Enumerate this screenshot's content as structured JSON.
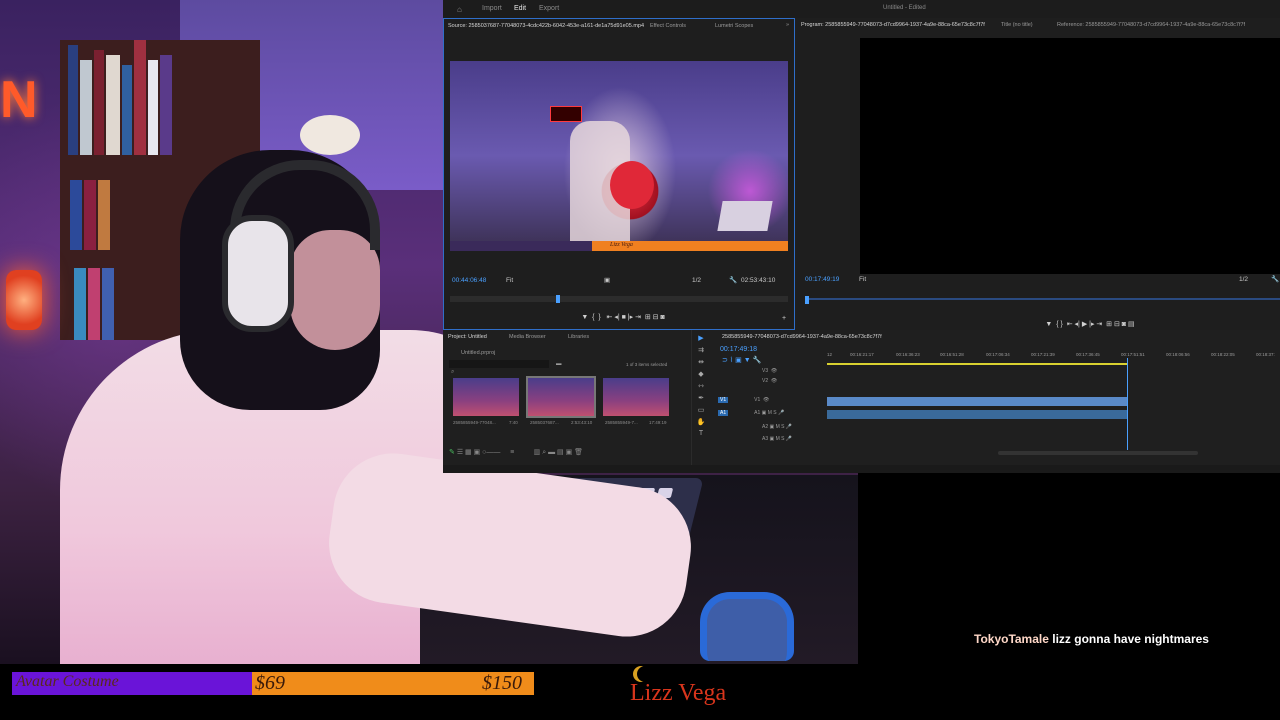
{
  "app": {
    "window_title": "Untitled - Edited",
    "menu": [
      "Import",
      "Edit",
      "Export"
    ],
    "active_menu": "Edit"
  },
  "source": {
    "tab_label": "Source: 2585037687-77048073-4cdc422b-6042-453e-a161-de1a75d91e05.mp4",
    "other_tabs": [
      "Effect Controls",
      "Lumetri Scopes"
    ],
    "timecode": "00:44:06:48",
    "fit": "Fit",
    "scale": "1/2",
    "duration": "02:53:43:10",
    "video_overlay_name": "Lizz Vega"
  },
  "program": {
    "tab_label": "Program: 2585855949-77048073-d7cd9964-1937-4a9e-88ca-65e73c8c7f7f",
    "other_tabs": [
      "Title (no title)",
      "Reference: 2585855949-77048073-d7cd9964-1937-4a9e-88ca-65e73c8c7f7f"
    ],
    "timecode": "00:17:49:19",
    "fit": "Fit",
    "scale": "1/2"
  },
  "project": {
    "tabs": [
      "Project: Untitled",
      "Media Browser",
      "Libraries"
    ],
    "bin": "Untitled.prproj",
    "selection_info": "1 of 3 items selected",
    "clips": [
      {
        "name": "2585855949-77048...",
        "duration": "7:40"
      },
      {
        "name": "2585037687...",
        "duration": "2:53:43:10"
      },
      {
        "name": "2585855949-7...",
        "duration": "17:49:19"
      }
    ]
  },
  "timeline": {
    "tab_label": "2585855949-77048073-d7cd9964-1937-4a9e-88ca-65e73c8c7f7f",
    "timecode": "00:17:49:18",
    "ruler": [
      "12",
      "00:16:21:17",
      "00:16:36:23",
      "00:16:51:28",
      "00:17:06:34",
      "00:17:21:39",
      "00:17:36:45",
      "00:17:51:51",
      "00:18:06:56",
      "00:18:22:05",
      "00:18:37:"
    ],
    "video_tracks": [
      "V3",
      "V2",
      "V1"
    ],
    "audio_tracks": [
      "A1",
      "A2",
      "A3"
    ]
  },
  "overlay": {
    "chat_user": "TokyoTamale",
    "chat_message": "lizz gonna have nightmares",
    "goal_label": "Avatar Costume",
    "goal_current": "$69",
    "goal_max": "$150",
    "goal_progress": 0.46,
    "streamer_logo": "Lizz Vega"
  },
  "colors": {
    "accent_blue": "#2f6ec9",
    "goal_purple": "#6a14d8",
    "goal_orange": "#f08c1a",
    "logo_red": "#d8351c"
  }
}
